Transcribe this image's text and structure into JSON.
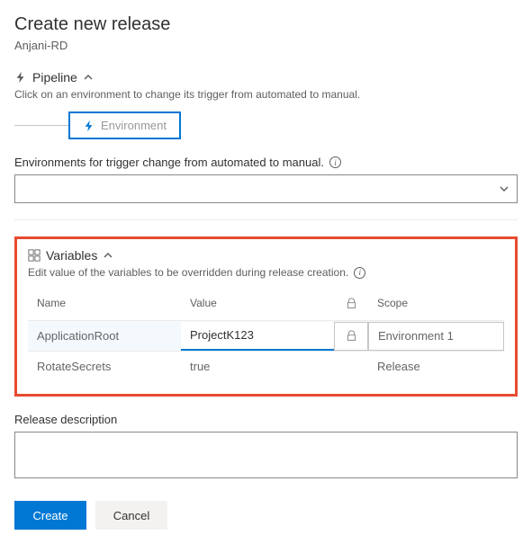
{
  "header": {
    "title": "Create new release",
    "subtitle": "Anjani-RD"
  },
  "pipeline": {
    "section_label": "Pipeline",
    "helper": "Click on an environment to change its trigger from automated to manual.",
    "env_box_label": "Environment"
  },
  "environments": {
    "label": "Environments for trigger change from automated to manual."
  },
  "variables": {
    "section_label": "Variables",
    "helper": "Edit value of the variables to be overridden during release creation.",
    "columns": {
      "name": "Name",
      "value": "Value",
      "scope": "Scope"
    },
    "rows": [
      {
        "name": "ApplicationRoot",
        "value": "ProjectK123",
        "scope": "Environment 1"
      },
      {
        "name": "RotateSecrets",
        "value": "true",
        "scope": "Release"
      }
    ]
  },
  "description": {
    "label": "Release description"
  },
  "buttons": {
    "create": "Create",
    "cancel": "Cancel"
  }
}
